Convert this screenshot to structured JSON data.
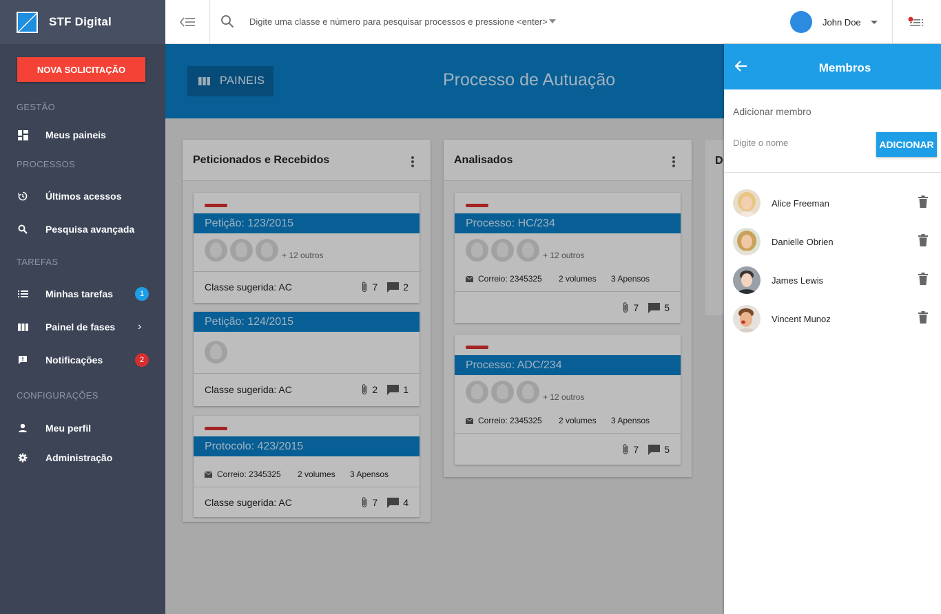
{
  "brand": {
    "name": "STF Digital"
  },
  "sidebar": {
    "new_button": "NOVA SOLICITAÇÃO",
    "sections": {
      "gestao": "GESTÃO",
      "processos": "PROCESSOS",
      "tarefas": "TAREFAS",
      "configuracoes": "CONFIGURAÇÕES"
    },
    "items": [
      {
        "label": "Meus paineis",
        "icon": "dashboard-icon"
      },
      {
        "label": "Últimos acessos",
        "icon": "history-icon"
      },
      {
        "label": "Pesquisa avançada",
        "icon": "search-icon"
      },
      {
        "label": "Minhas tarefas",
        "icon": "list-icon",
        "badge": "1",
        "badge_color": "#1e9ee6"
      },
      {
        "label": "Painel de fases",
        "icon": "columns-icon",
        "arrow": "›"
      },
      {
        "label": "Notificações",
        "icon": "feedback-icon",
        "badge": "2",
        "badge_color": "#d32f2f"
      },
      {
        "label": "Meu perfil",
        "icon": "person-icon"
      },
      {
        "label": "Administração",
        "icon": "gear-icon"
      }
    ]
  },
  "topbar": {
    "search_text": "Digite uma classe e número para pesquisar processos e pressione <enter>",
    "user_name": "John Doe"
  },
  "header": {
    "paineis_label": "PAINEIS",
    "title": "Processo de Autuação"
  },
  "columns": [
    {
      "title": "Peticionados e Recebidos",
      "cards": [
        {
          "title": "Petição: 123/2015",
          "others": "+ 12 outros",
          "suggest": "Classe sugerida: AC",
          "attachments": "7",
          "comments": "2"
        },
        {
          "title": "Petição: 124/2015",
          "suggest": "Classe sugerida: AC",
          "attachments": "2",
          "comments": "1"
        },
        {
          "title": "Protocolo: 423/2015",
          "correio": "Correio: 2345325",
          "volumes": "2 volumes",
          "apensos": "3 Apensos",
          "suggest": "Classe sugerida: AC",
          "attachments": "7",
          "comments": "4"
        }
      ]
    },
    {
      "title": "Analisados",
      "cards": [
        {
          "title": "Processo: HC/234",
          "others": "+ 12 outros",
          "correio": "Correio: 2345325",
          "volumes": "2 volumes",
          "apensos": "3 Apensos",
          "attachments": "7",
          "comments": "5"
        },
        {
          "title": "Processo: ADC/234",
          "others": "+ 12 outros",
          "correio": "Correio: 2345325",
          "volumes": "2 volumes",
          "apensos": "3 Apensos",
          "attachments": "7",
          "comments": "5"
        }
      ]
    },
    {
      "title": "D"
    }
  ],
  "panel": {
    "title": "Membros",
    "add_label": "Adicionar membro",
    "input_placeholder": "Digite o nome",
    "add_button": "ADICIONAR",
    "members": [
      {
        "name": "Alice Freeman"
      },
      {
        "name": "Danielle Obrien"
      },
      {
        "name": "James Lewis"
      },
      {
        "name": "Vincent Munoz"
      }
    ]
  },
  "colors": {
    "sidebar": "#3c4456",
    "accent_blue": "#0a7ac0",
    "panel_blue": "#1e9ee6",
    "danger": "#f44336"
  }
}
